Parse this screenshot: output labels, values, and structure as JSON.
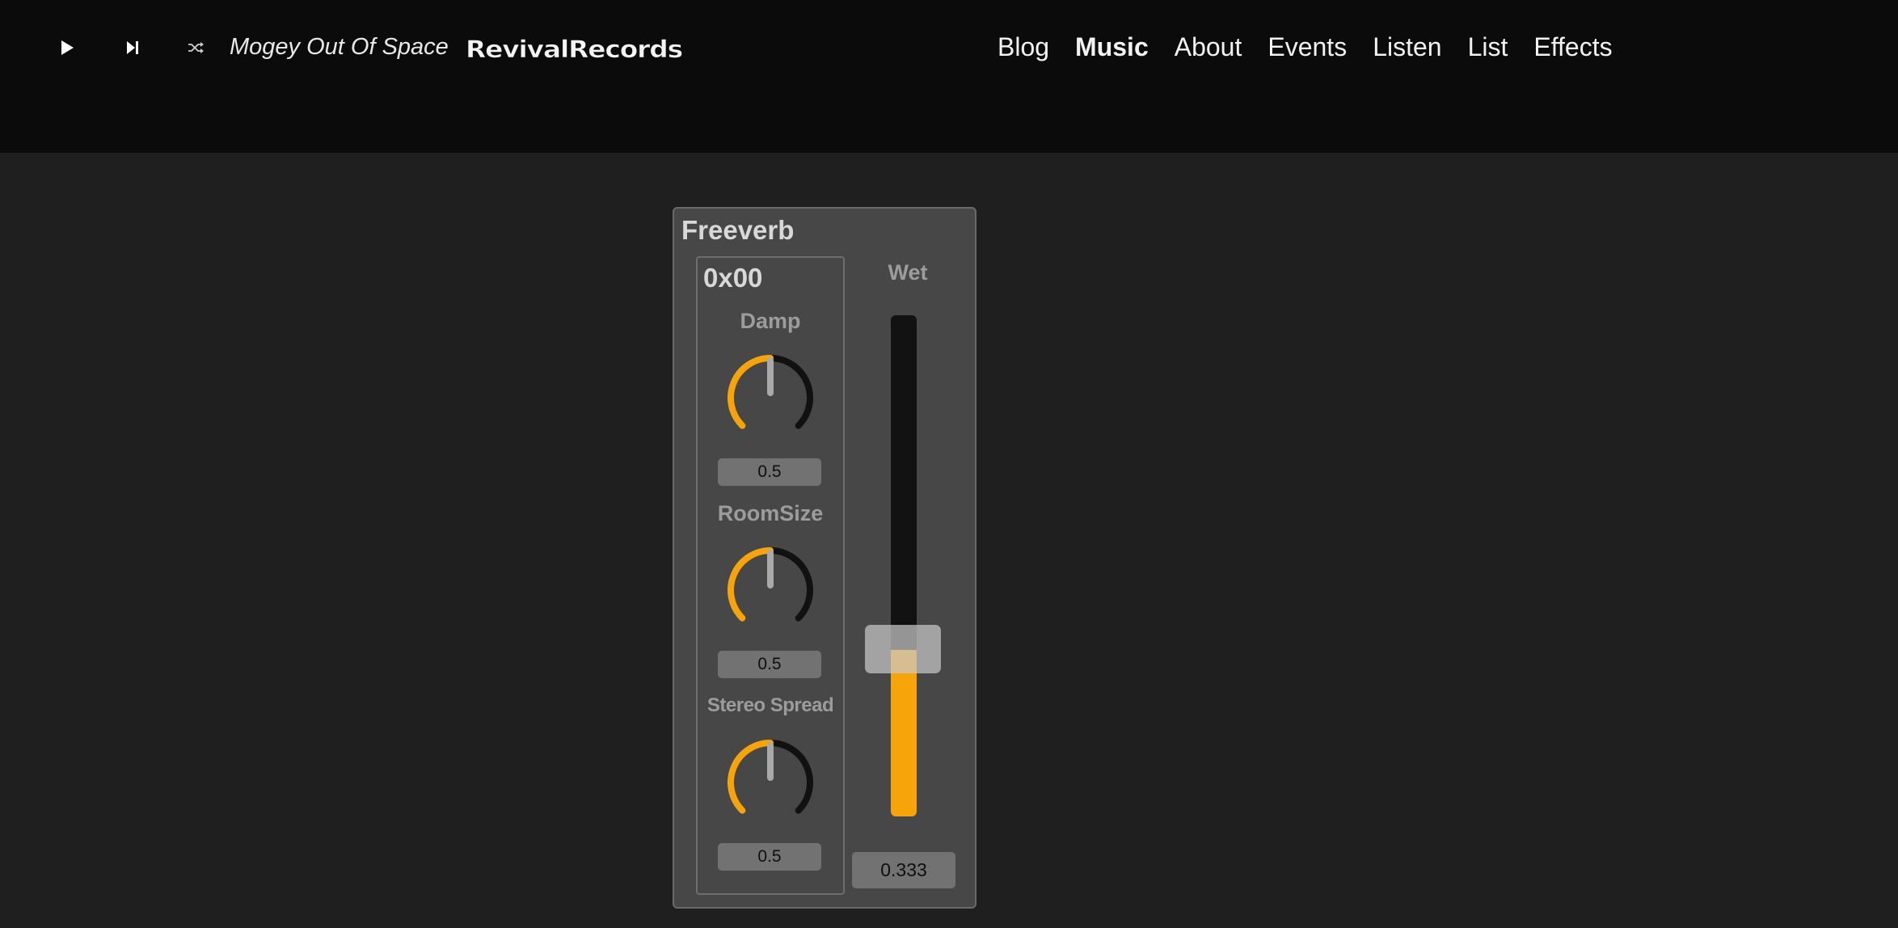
{
  "player": {
    "play_icon": "play-icon",
    "next_icon": "skip-next-icon",
    "shuffle_icon": "shuffle-icon",
    "now_playing": "Mogey Out Of Space"
  },
  "brand": {
    "name": "RevivalRecords"
  },
  "nav": {
    "items": [
      {
        "label": "Blog",
        "active": false
      },
      {
        "label": "Music",
        "active": true
      },
      {
        "label": "About",
        "active": false
      },
      {
        "label": "Events",
        "active": false
      },
      {
        "label": "Listen",
        "active": false
      },
      {
        "label": "List",
        "active": false
      },
      {
        "label": "Effects",
        "active": false
      }
    ]
  },
  "effect": {
    "title": "Freeverb",
    "group_title": "0x00",
    "params": [
      {
        "label": "Damp",
        "value": "0.5",
        "level": 0.5
      },
      {
        "label": "RoomSize",
        "value": "0.5",
        "level": 0.5
      },
      {
        "label": "Stereo Spread",
        "value": "0.5",
        "level": 0.5
      }
    ],
    "wet": {
      "label": "Wet",
      "value": "0.333",
      "level": 0.333
    }
  },
  "colors": {
    "accent": "#f7a40a",
    "header_bg": "#0b0b0b",
    "page_bg": "#1f1f1f",
    "panel_bg": "#474747"
  }
}
